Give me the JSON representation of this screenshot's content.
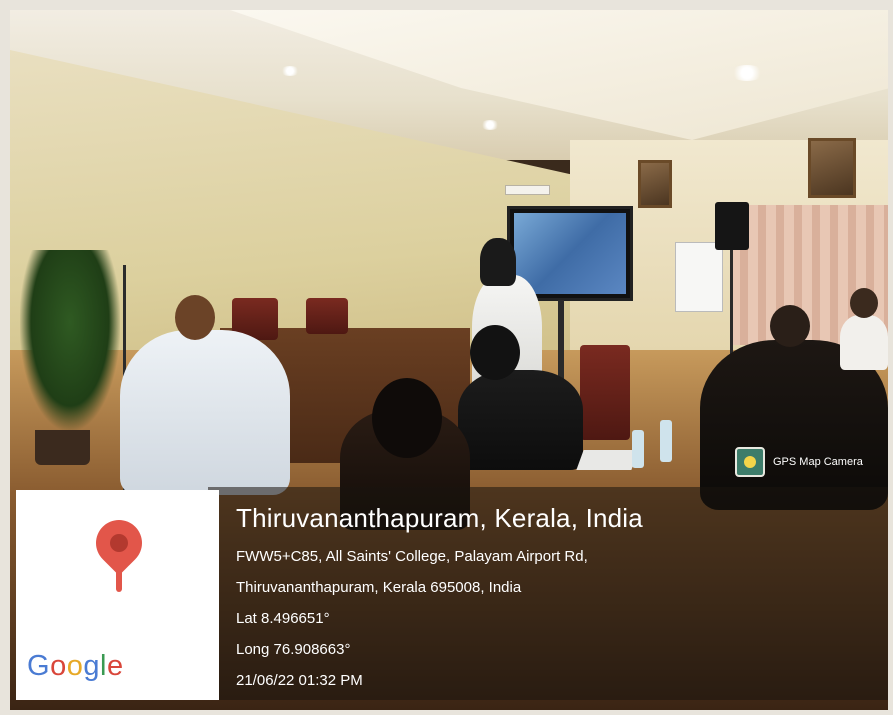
{
  "photo": {
    "scene": ""
  },
  "badge": {
    "text": "GPS Map Camera",
    "icon": "gps-map-camera-icon"
  },
  "location": {
    "title": "Thiruvananthapuram, Kerala, India",
    "address_line1": "FWW5+C85, All Saints' College, Palayam Airport Rd,",
    "address_line2": "Thiruvananthapuram, Kerala 695008, India",
    "lat": "Lat 8.496651°",
    "long": "Long 76.908663°",
    "datetime": "21/06/22 01:32 PM"
  },
  "map": {
    "icon": "map-pin-icon",
    "logo": "Google",
    "colors": {
      "pin": "#e2564a",
      "blue": "#4a7bd3",
      "red": "#d9463a",
      "yellow": "#e7a927",
      "green": "#3a9a52"
    }
  }
}
